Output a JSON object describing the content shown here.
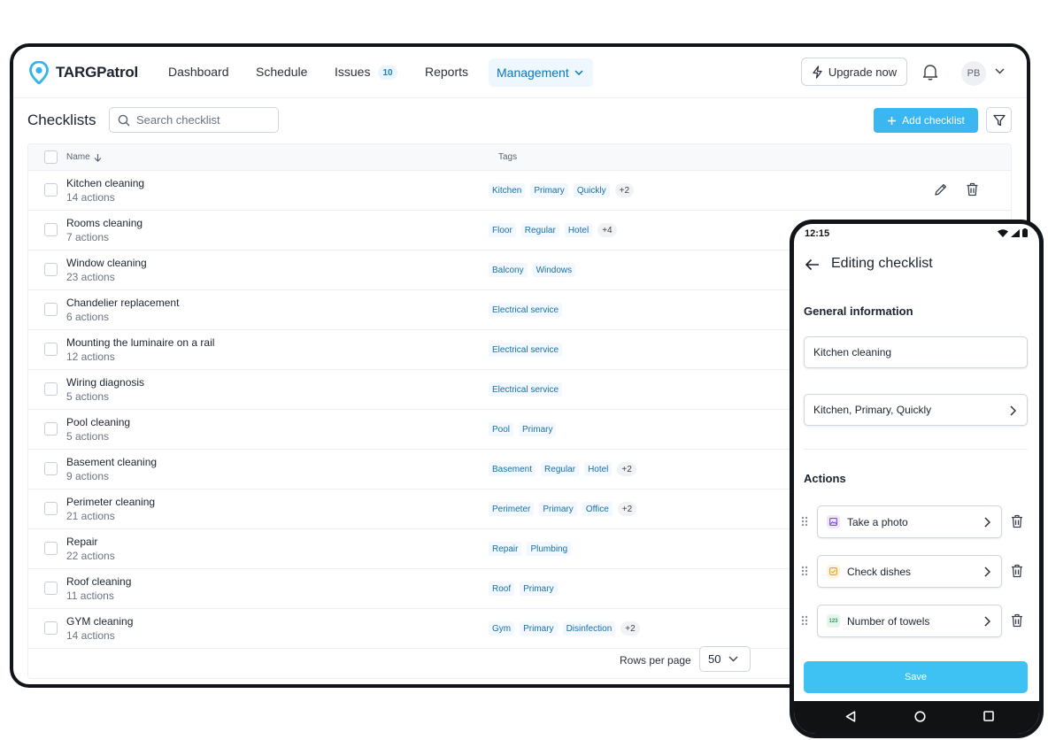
{
  "app": {
    "brand": "TARGPatrol",
    "accent": "#3ab7f0"
  },
  "nav": {
    "dashboard": "Dashboard",
    "schedule": "Schedule",
    "issues": "Issues",
    "issues_count": "10",
    "reports": "Reports",
    "management": "Management",
    "upgrade": "Upgrade now",
    "avatar_initials": "PB"
  },
  "page": {
    "title": "Checklists",
    "search_placeholder": "Search checklist",
    "add_button": "Add checklist"
  },
  "table": {
    "col_name": "Name",
    "col_tags": "Tags",
    "rows": [
      {
        "name": "Kitchen cleaning",
        "sub": "14 actions",
        "tags": [
          "Kitchen",
          "Primary",
          "Quickly"
        ],
        "more": "+2"
      },
      {
        "name": "Rooms cleaning",
        "sub": "7 actions",
        "tags": [
          "Floor",
          "Regular",
          "Hotel"
        ],
        "more": "+4"
      },
      {
        "name": "Window cleaning",
        "sub": "23 actions",
        "tags": [
          "Balcony",
          "Windows"
        ],
        "more": ""
      },
      {
        "name": "Chandelier replacement",
        "sub": "6 actions",
        "tags": [
          "Electrical service"
        ],
        "more": ""
      },
      {
        "name": "Mounting the luminaire on a rail",
        "sub": "12 actions",
        "tags": [
          "Electrical service"
        ],
        "more": ""
      },
      {
        "name": "Wiring diagnosis",
        "sub": "5 actions",
        "tags": [
          "Electrical service"
        ],
        "more": ""
      },
      {
        "name": "Pool cleaning",
        "sub": "5 actions",
        "tags": [
          "Pool",
          "Primary"
        ],
        "more": ""
      },
      {
        "name": "Basement cleaning",
        "sub": "9 actions",
        "tags": [
          "Basement",
          "Regular",
          "Hotel"
        ],
        "more": "+2"
      },
      {
        "name": "Perimeter cleaning",
        "sub": "21 actions",
        "tags": [
          "Perimeter",
          "Primary",
          "Office"
        ],
        "more": "+2"
      },
      {
        "name": "Repair",
        "sub": "22 actions",
        "tags": [
          "Repair",
          "Plumbing"
        ],
        "more": ""
      },
      {
        "name": "Roof cleaning",
        "sub": "11 actions",
        "tags": [
          "Roof",
          "Primary"
        ],
        "more": ""
      },
      {
        "name": "GYM cleaning",
        "sub": "14 actions",
        "tags": [
          "Gym",
          "Primary",
          "Disinfection"
        ],
        "more": "+2"
      }
    ]
  },
  "pagination": {
    "rows_label": "Rows per page",
    "rows_value": "50"
  },
  "phone": {
    "time": "12:15",
    "title": "Editing checklist",
    "general_heading": "General information",
    "name_value": "Kitchen cleaning",
    "tags_value": "Kitchen, Primary, Quickly",
    "actions_heading": "Actions",
    "actions": [
      {
        "label": "Take a photo",
        "icon": "photo-icon",
        "color": "#7b4de0",
        "bg": "#efe8fc",
        "glyph": ""
      },
      {
        "label": "Check dishes",
        "icon": "checkbox-icon",
        "color": "#f0a020",
        "bg": "#fff4df",
        "glyph": ""
      },
      {
        "label": "Number of towels",
        "icon": "number-icon",
        "color": "#2f9a63",
        "bg": "#e4f5ec",
        "glyph": "123"
      }
    ],
    "save": "Save"
  }
}
